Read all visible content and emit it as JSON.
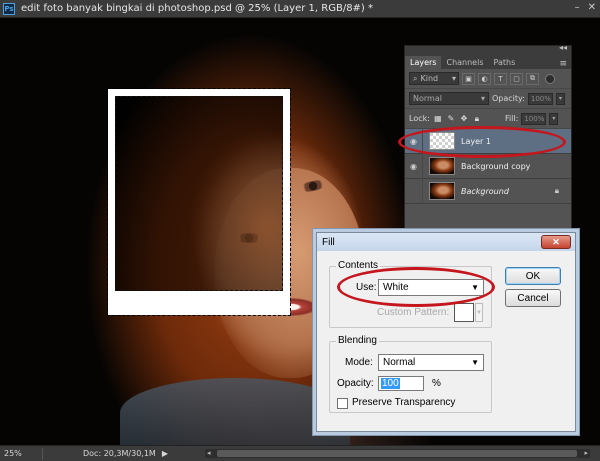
{
  "window": {
    "app_icon": "Ps",
    "title": "edit foto banyak bingkai di photoshop.psd @ 25% (Layer 1, RGB/8#) *",
    "minimize": "–",
    "close": "✕"
  },
  "layers_panel": {
    "collapse": "◂◂",
    "tabs": [
      {
        "label": "Layers",
        "active": true
      },
      {
        "label": "Channels",
        "active": false
      },
      {
        "label": "Paths",
        "active": false
      }
    ],
    "menu_icon": "≡",
    "filter_label": "Kind",
    "filter_icons": [
      "image-icon",
      "adjustment-icon",
      "type-icon",
      "shape-icon",
      "smart-object-icon"
    ],
    "blend_mode": "Normal",
    "opacity_label": "Opacity:",
    "opacity_value": "100%",
    "lock_label": "Lock:",
    "fill_label": "Fill:",
    "fill_value": "100%",
    "layers": [
      {
        "name": "Layer 1",
        "selected": true,
        "thumb": "transparent"
      },
      {
        "name": "Background copy",
        "selected": false,
        "thumb": "photo"
      },
      {
        "name": "Background",
        "selected": false,
        "thumb": "photo",
        "locked": true
      }
    ]
  },
  "fill_dialog": {
    "title": "Fill",
    "contents_label": "Contents",
    "use_label": "Use:",
    "use_value": "White",
    "custom_pattern_label": "Custom Pattern:",
    "blending_label": "Blending",
    "mode_label": "Mode:",
    "mode_value": "Normal",
    "opacity_label": "Opacity:",
    "opacity_value": "100",
    "opacity_unit": "%",
    "preserve_label": "Preserve Transparency",
    "preserve_checked": false,
    "ok_label": "OK",
    "cancel_label": "Cancel"
  },
  "status_bar": {
    "zoom": "25%",
    "doc_info": "Doc: 20,3M/30,1M"
  },
  "colors": {
    "highlight_ellipse": "#c4161c",
    "selected_layer": "#5e6f84"
  }
}
